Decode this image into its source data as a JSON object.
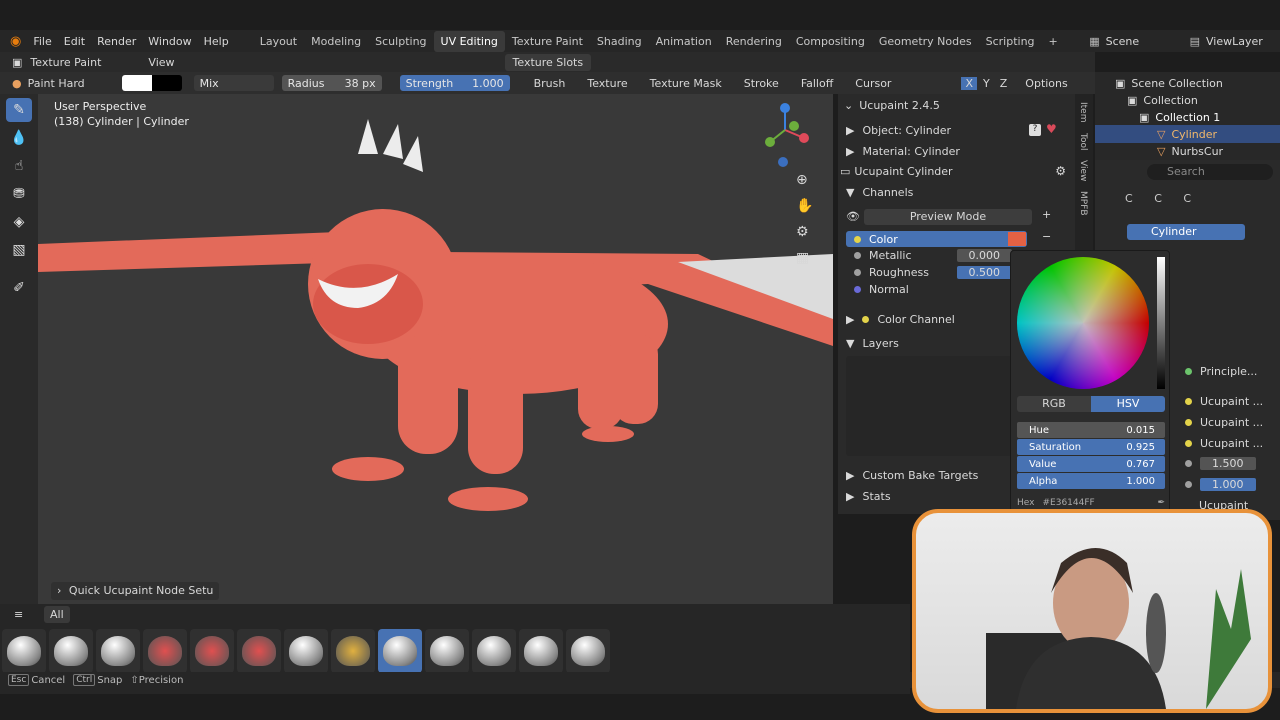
{
  "menu": {
    "items": [
      "File",
      "Edit",
      "Render",
      "Window",
      "Help"
    ]
  },
  "workspaces": {
    "tabs": [
      "Layout",
      "Modeling",
      "Sculpting",
      "UV Editing",
      "Texture Paint",
      "Shading",
      "Animation",
      "Rendering",
      "Compositing",
      "Geometry Nodes",
      "Scripting"
    ],
    "active": "UV Editing",
    "add": "+"
  },
  "scene": {
    "name": "Scene",
    "view_layer": "ViewLayer"
  },
  "editor": {
    "mode": "Texture Paint",
    "view_menu": "View",
    "texture_slots": "Texture Slots"
  },
  "tool_settings": {
    "brush_name": "Paint Hard",
    "blend": "Mix",
    "radius_label": "Radius",
    "radius_value": "38 px",
    "strength_label": "Strength",
    "strength_value": "1.000",
    "menus": [
      "Brush",
      "Texture",
      "Texture Mask",
      "Stroke",
      "Falloff",
      "Cursor"
    ],
    "axes": [
      "X",
      "Y",
      "Z"
    ],
    "options": "Options"
  },
  "viewport": {
    "perspective": "User Perspective",
    "object_info": "(138) Cylinder | Cylinder"
  },
  "npanel": {
    "title": "Ucupaint 2.4.5",
    "object": "Object: Cylinder",
    "material": "Material: Cylinder",
    "ucupaint_name": "Ucupaint Cylinder",
    "channels_header": "Channels",
    "preview_mode": "Preview Mode",
    "channels": [
      {
        "name": "Color",
        "value": "",
        "color": "#e3d34a"
      },
      {
        "name": "Metallic",
        "value": "0.000",
        "color": "#a0a0a0"
      },
      {
        "name": "Roughness",
        "value": "0.500",
        "color": "#a0a0a0"
      },
      {
        "name": "Normal",
        "value": "",
        "color": "#6a6ad8"
      }
    ],
    "color_channel": "Color Channel",
    "layers_header": "Layers",
    "custom_bake": "Custom Bake Targets",
    "stats": "Stats",
    "side_tabs": [
      "Item",
      "Tool",
      "View",
      "MPFB"
    ]
  },
  "color_picker": {
    "mode_rgb": "RGB",
    "mode_hsv": "HSV",
    "hue_label": "Hue",
    "hue": "0.015",
    "saturation_label": "Saturation",
    "saturation": "0.925",
    "value_label": "Value",
    "value": "0.767",
    "alpha_label": "Alpha",
    "alpha": "1.000",
    "hex_label": "Hex",
    "hex": "#E36144FF",
    "swatch": "#e36144"
  },
  "outliner": {
    "search_placeholder": "Search",
    "items": [
      {
        "label": "Scene Collection"
      },
      {
        "label": "Collection"
      },
      {
        "label": "Collection 1"
      },
      {
        "label": "Cylinder"
      },
      {
        "label": "NurbsCur"
      }
    ]
  },
  "properties": {
    "search_placeholder": "Search",
    "crumbs": [
      "C",
      "C",
      "C"
    ],
    "object_name": "Cylinder",
    "node_items": [
      "Principle...",
      "Ucupaint ...",
      "Ucupaint ...",
      "Ucupaint ..."
    ],
    "val1": "1.500",
    "val2": "1.000",
    "trailing": "Ucupaint"
  },
  "bottom": {
    "quick_setup": "Quick Ucupaint Node Setu",
    "tab_all": "All"
  },
  "status": {
    "k1": "Esc",
    "a1": "Cancel",
    "k2": "Ctrl",
    "a2": "Snap",
    "a3": "Precision"
  },
  "colors": {
    "accent": "#4772b3",
    "dragon": "#e36a5a",
    "webcam_border": "#e8923a"
  }
}
